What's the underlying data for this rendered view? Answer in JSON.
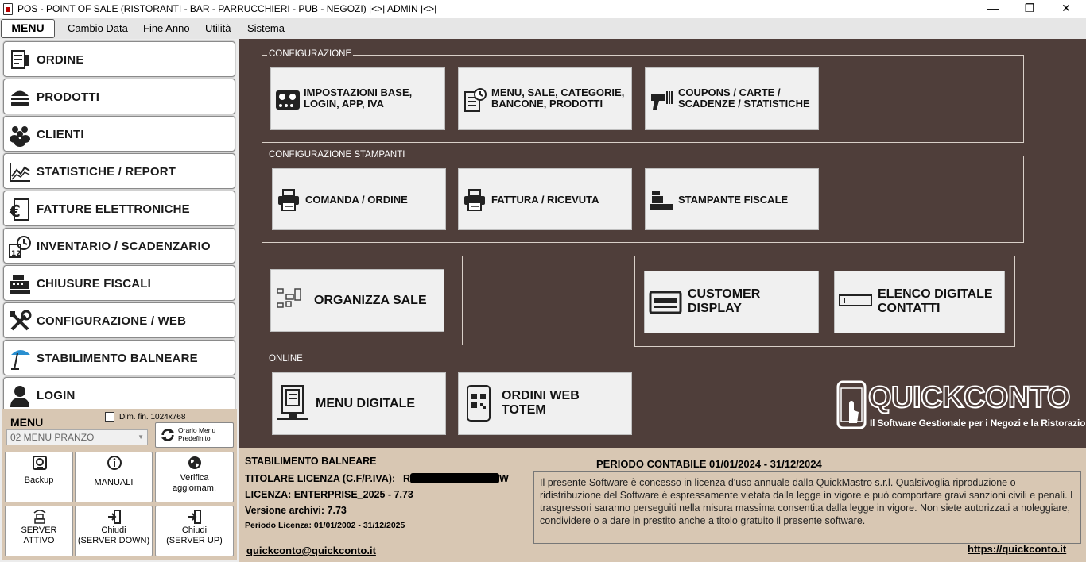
{
  "window": {
    "title": "POS - POINT OF SALE (RISTORANTI - BAR - PARRUCCHIERI - PUB - NEGOZI)   |<>| ADMIN |<>|",
    "minimize": "—",
    "maximize": "❐",
    "close": "✕"
  },
  "menubar": {
    "menu_button": "MENU",
    "items": [
      "Cambio Data",
      "Fine Anno",
      "Utilità",
      "Sistema"
    ]
  },
  "sidebar": {
    "items": [
      {
        "label": "ORDINE",
        "icon": "order-icon"
      },
      {
        "label": "PRODOTTI",
        "icon": "burger-icon"
      },
      {
        "label": "CLIENTI",
        "icon": "people-icon"
      },
      {
        "label": "STATISTICHE / REPORT",
        "icon": "chart-icon"
      },
      {
        "label": "FATTURE ELETTRONICHE",
        "icon": "euro-invoice-icon"
      },
      {
        "label": "INVENTARIO / SCADENZARIO",
        "icon": "calendar-clock-icon"
      },
      {
        "label": "CHIUSURE FISCALI",
        "icon": "cash-register-icon"
      },
      {
        "label": "CONFIGURAZIONE / WEB",
        "icon": "tools-icon"
      },
      {
        "label": "STABILIMENTO BALNEARE",
        "icon": "umbrella-icon"
      },
      {
        "label": "LOGIN",
        "icon": "user-icon"
      }
    ],
    "bottom": {
      "menu_title": "MENU",
      "checkbox_label": "Dim. fin. 1024x768",
      "select_value": "02 MENU PRANZO",
      "orario_line1": "Orario Menu",
      "orario_line2": "Predefinito",
      "tiles": [
        {
          "line1": "Backup",
          "line2": "",
          "icon": "backup-icon"
        },
        {
          "line1": "MANUALI",
          "line2": "",
          "icon": "info-icon"
        },
        {
          "line1": "Verifica",
          "line2": "aggiornam.",
          "icon": "globe-icon"
        },
        {
          "line1": "SERVER",
          "line2": "ATTIVO",
          "icon": "server-icon"
        },
        {
          "line1": "Chiudi",
          "line2": "(SERVER DOWN)",
          "icon": "exit-icon"
        },
        {
          "line1": "Chiudi",
          "line2": "(SERVER UP)",
          "icon": "exit-icon"
        }
      ]
    }
  },
  "main": {
    "groups": {
      "configurazione": "CONFIGURAZIONE",
      "stampanti": "CONFIGURAZIONE STAMPANTI",
      "online": "ONLINE"
    },
    "buttons": {
      "impostazioni": {
        "line1": "IMPOSTAZIONI BASE,",
        "line2": "LOGIN, APP, IVA"
      },
      "menu_sale": {
        "line1": "MENU, SALE, CATEGORIE,",
        "line2": "BANCONE, PRODOTTI"
      },
      "coupons": {
        "line1": "COUPONS / CARTE /",
        "line2": "SCADENZE / STATISTICHE"
      },
      "comanda": {
        "line1": "COMANDA / ORDINE"
      },
      "fattura": {
        "line1": "FATTURA / RICEVUTA"
      },
      "fiscale": {
        "line1": "STAMPANTE FISCALE"
      },
      "organizza": {
        "line1": "ORGANIZZA SALE"
      },
      "customer": {
        "line1": "CUSTOMER",
        "line2": "DISPLAY"
      },
      "elenco": {
        "line1": "ELENCO DIGITALE",
        "line2": "CONTATTI"
      },
      "menu_digitale": {
        "line1": "MENU DIGITALE"
      },
      "ordini_web": {
        "line1": "ORDINI WEB",
        "line2": "TOTEM"
      }
    },
    "logo": {
      "brand": "QUICKCONTO",
      "tagline": "Il Software Gestionale per i Negozi e la Ristorazione"
    }
  },
  "info": {
    "module": "STABILIMENTO BALNEARE",
    "periodo": "PERIODO CONTABILE 01/01/2024 - 31/12/2024",
    "titolare_label": "TITOLARE LICENZA (C.F/P.IVA):",
    "titolare_prefix": "RI",
    "titolare_suffix": "W",
    "licenza": "LICENZA: ENTERPRISE_2025 - 7.73",
    "versione": "Versione archivi: 7.73",
    "periodo_licenza": "Periodo Licenza:  01/01/2002 - 31/12/2025",
    "notice": "Il presente Software è concesso in licenza d'uso annuale dalla QuickMastro s.r.l. Qualsivoglia riproduzione o ridistribuzione del Software è espressamente vietata dalla legge in vigore e può comportare gravi sanzioni civili e penali. I trasgressori saranno perseguiti nella misura massima consentita dalla legge in vigore. Non siete autorizzati a noleggiare, condividere o a dare in prestito anche a titolo gratuito il presente software.",
    "email": "quickconto@quickconto.it",
    "website": "https://quickconto.it"
  }
}
